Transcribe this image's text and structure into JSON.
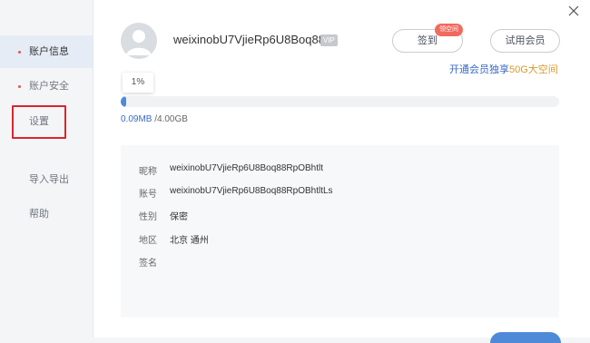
{
  "sidebar": {
    "items": [
      {
        "label": "账户信息",
        "active": true,
        "dot": true
      },
      {
        "label": "账户安全",
        "active": false,
        "dot": true
      },
      {
        "label": "设置",
        "active": false,
        "dot": false
      },
      {
        "label": "导入导出",
        "active": false,
        "dot": false
      },
      {
        "label": "帮助",
        "active": false,
        "dot": false
      }
    ]
  },
  "profile": {
    "username": "weixinobU7VjieRp6U8Boq88..",
    "vip_badge": "VIP"
  },
  "actions": {
    "checkin_label": "签到",
    "checkin_bubble": "领空间",
    "trial_label": "试用会员"
  },
  "promo": {
    "prefix": "开通会员独享",
    "highlight": "50G大空间"
  },
  "storage": {
    "percent_label": "1%",
    "used_fraction": 0.01,
    "used": "0.09MB",
    "total": " /4.00GB"
  },
  "info": {
    "rows": [
      {
        "key": "昵称",
        "value": "weixinobU7VjieRp6U8Boq88RpOBhtlt"
      },
      {
        "key": "账号",
        "value": "weixinobU7VjieRp6U8Boq88RpOBhtltLs"
      },
      {
        "key": "性别",
        "value": "保密"
      },
      {
        "key": "地区",
        "value": "北京 通州"
      },
      {
        "key": "签名",
        "value": ""
      }
    ]
  },
  "colors": {
    "accent": "#4f8ad9",
    "highlight_border": "#d9252e",
    "promo_gold": "#d89a2a"
  }
}
